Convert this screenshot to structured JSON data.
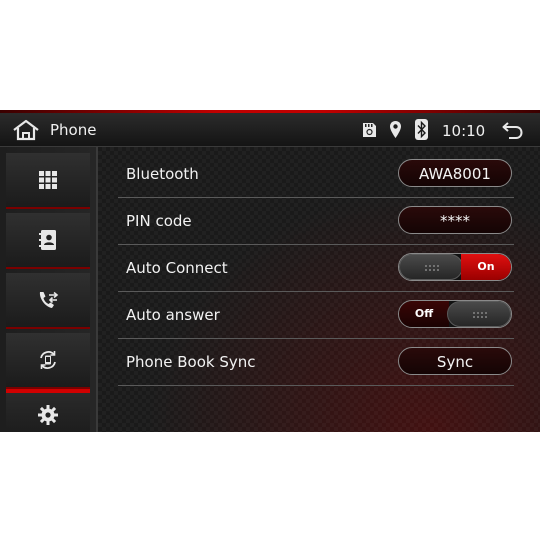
{
  "header": {
    "title": "Phone",
    "clock": "10:10"
  },
  "sidebar": {
    "items": [
      {
        "icon": "apps-grid-icon"
      },
      {
        "icon": "contacts-book-icon"
      },
      {
        "icon": "call-log-icon"
      },
      {
        "icon": "phone-sync-icon"
      },
      {
        "icon": "gear-icon",
        "active": true
      }
    ]
  },
  "settings": {
    "bluetooth": {
      "label": "Bluetooth",
      "value": "AWA8001"
    },
    "pin_code": {
      "label": "PIN code",
      "value": "****"
    },
    "auto_connect": {
      "label": "Auto Connect",
      "state": "On"
    },
    "auto_answer": {
      "label": "Auto answer",
      "state": "Off"
    },
    "phone_book_sync": {
      "label": "Phone Book Sync",
      "button": "Sync"
    }
  },
  "colors": {
    "accent": "#d00000",
    "background": "#161616",
    "text": "#f2f2f2"
  }
}
